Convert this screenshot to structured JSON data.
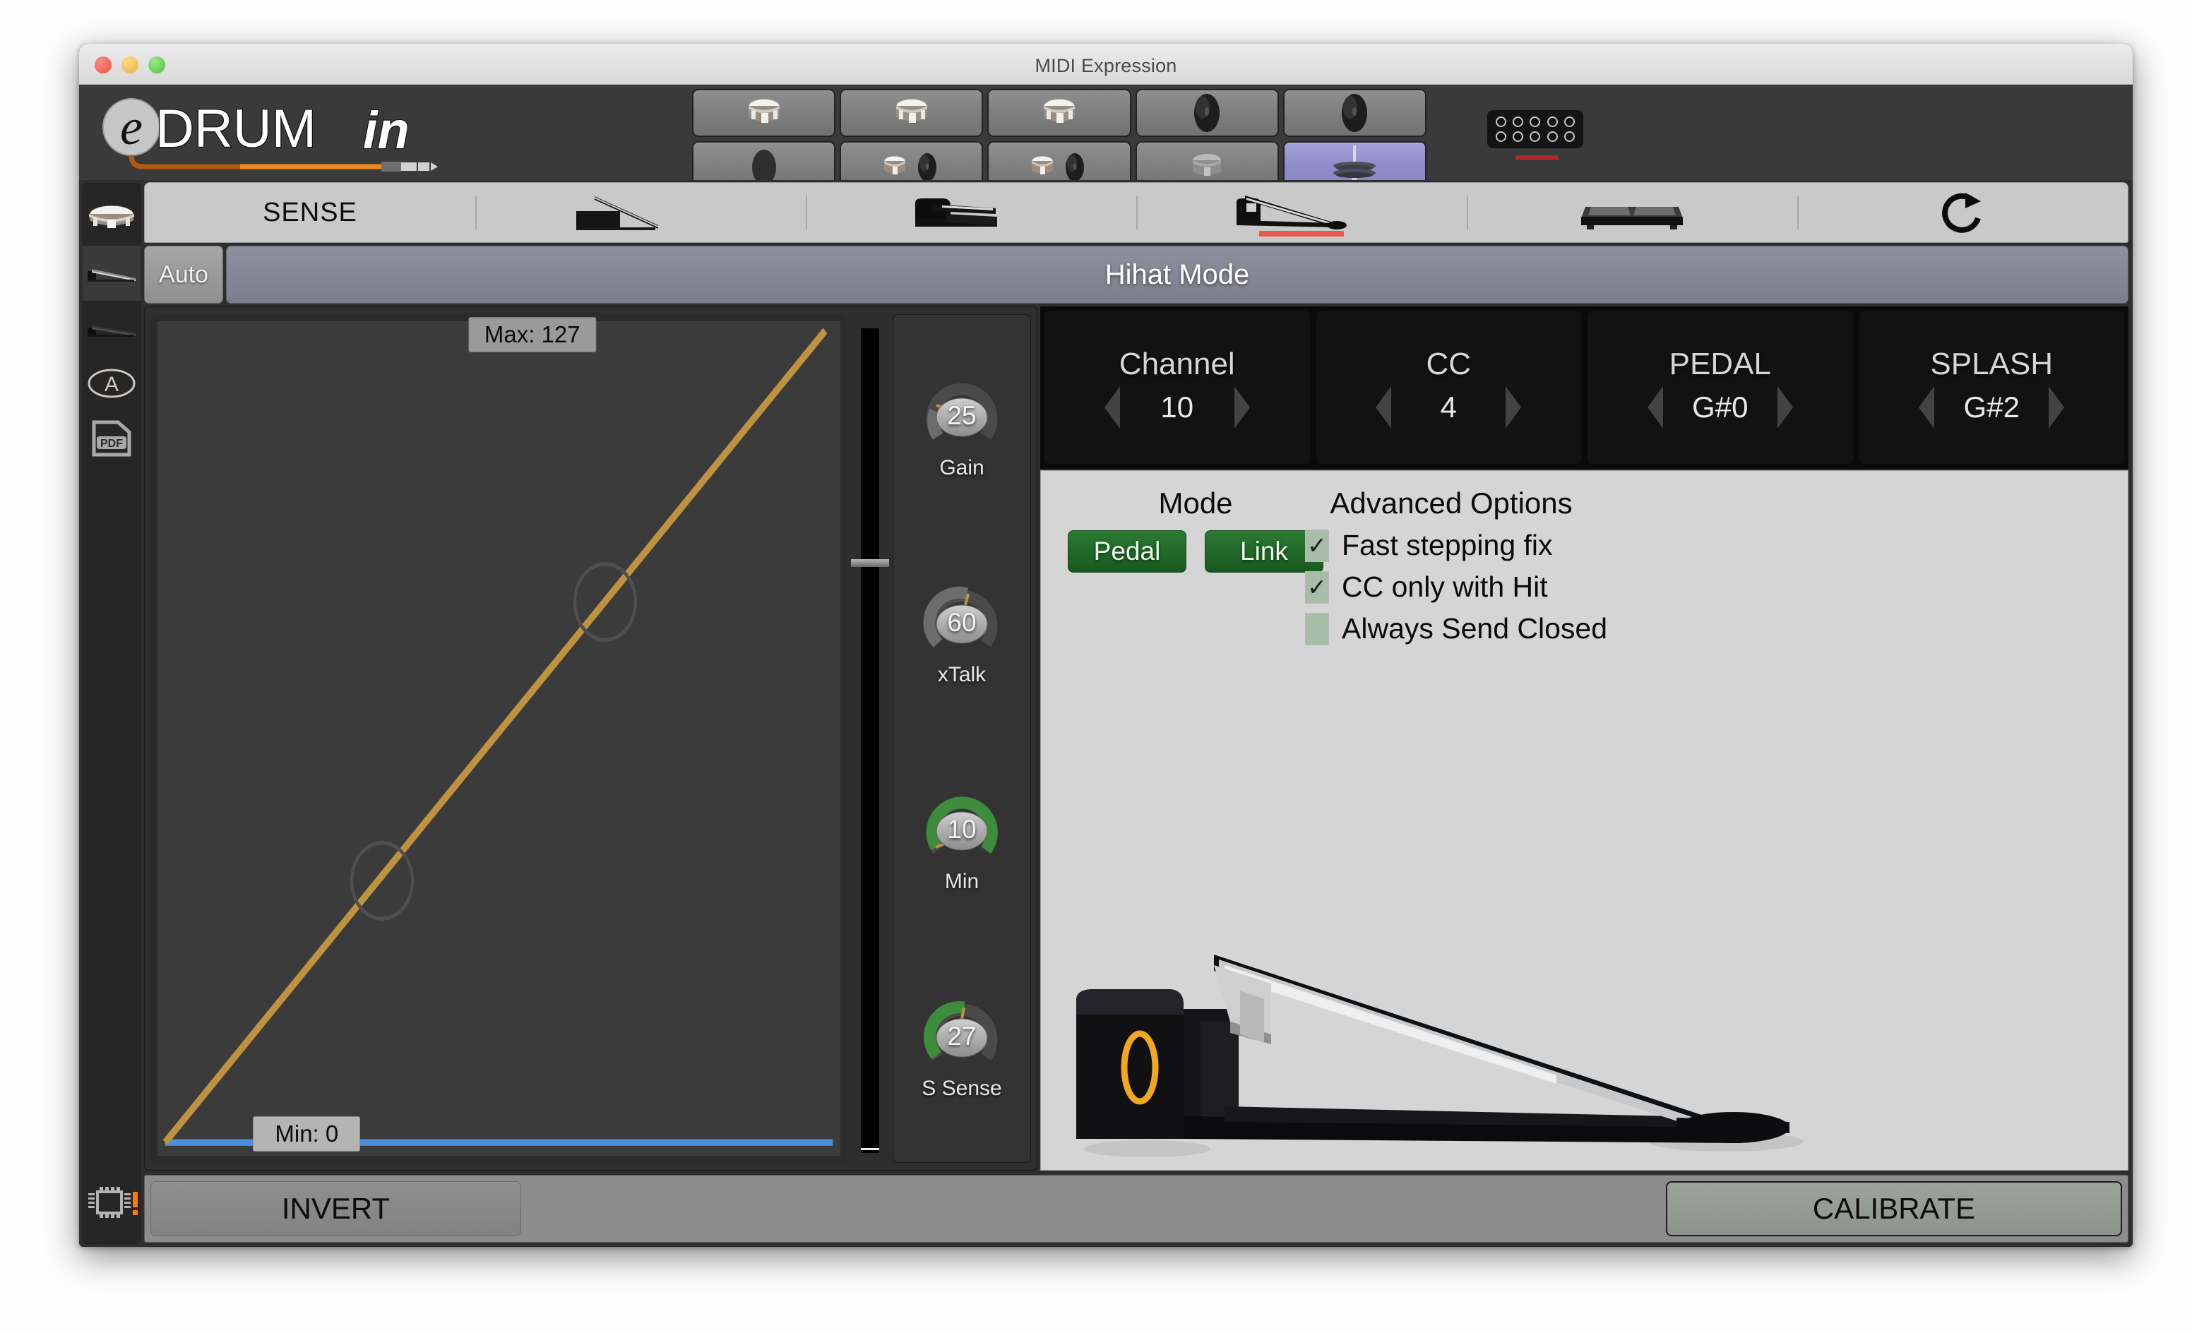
{
  "window": {
    "title": "MIDI Expression",
    "traffic_lights": [
      "close-button",
      "minimize-button",
      "maximize-button"
    ]
  },
  "brand": {
    "logo_text_a": "e",
    "logo_text_b": "DRUM",
    "logo_text_c": "in",
    "accent_orange": "#e87e1e"
  },
  "pads": [
    {
      "name": "pad-1-drum",
      "icon": "snare-drum-icon",
      "selected": false
    },
    {
      "name": "pad-2-drum",
      "icon": "snare-drum-icon",
      "selected": false
    },
    {
      "name": "pad-3-drum",
      "icon": "snare-drum-icon",
      "selected": false
    },
    {
      "name": "pad-4-cymbal",
      "icon": "cymbal-icon",
      "selected": false
    },
    {
      "name": "pad-5-cymbal",
      "icon": "cymbal-icon",
      "selected": false
    },
    {
      "name": "pad-6-empty",
      "icon": "empty-pad-icon",
      "selected": false
    },
    {
      "name": "pad-7-drum-cymbal",
      "icon": "drum-cymbal-pair-icon",
      "selected": false
    },
    {
      "name": "pad-8-drum-cymbal",
      "icon": "drum-cymbal-pair-icon",
      "selected": false
    },
    {
      "name": "pad-9-drum-dim",
      "icon": "drum-dim-icon",
      "selected": false
    },
    {
      "name": "pad-10-hihat",
      "icon": "hihat-icon",
      "selected": true
    }
  ],
  "led_panel": {
    "rows": 2,
    "columns": 5,
    "bar_color": "#b02a2a"
  },
  "sidebar": {
    "items": [
      {
        "name": "sidebar-item-drum",
        "icon": "snare-drum-icon",
        "active": false
      },
      {
        "name": "sidebar-item-pedal-1",
        "icon": "pedal-icon",
        "active": true
      },
      {
        "name": "sidebar-item-pedal-2",
        "icon": "pedal-icon",
        "active": false
      },
      {
        "name": "sidebar-item-auto",
        "icon": "circle-a-icon",
        "active": false
      },
      {
        "name": "sidebar-item-pdf",
        "icon": "pdf-icon",
        "label": "PDF",
        "active": false
      },
      {
        "name": "sidebar-item-firmware",
        "icon": "chip-icon",
        "active": false,
        "alert": true
      }
    ]
  },
  "tabs": [
    {
      "name": "tab-sense",
      "label": "SENSE",
      "icon": null,
      "selected": false
    },
    {
      "name": "tab-pedal-flat",
      "label": "",
      "icon": "pedal-flat-icon",
      "selected": false
    },
    {
      "name": "tab-pedal-down",
      "label": "",
      "icon": "pedal-down-icon",
      "selected": false
    },
    {
      "name": "tab-pedal-open",
      "label": "",
      "icon": "pedal-open-icon",
      "selected": true
    },
    {
      "name": "tab-switch",
      "label": "",
      "icon": "dual-switch-icon",
      "selected": false
    },
    {
      "name": "tab-refresh",
      "label": "",
      "icon": "refresh-icon",
      "selected": false
    }
  ],
  "mode_bar": {
    "auto_label": "Auto",
    "title": "Hihat Mode"
  },
  "chart_data": {
    "type": "line",
    "title": "",
    "max_label": "Max: 127",
    "min_label": "Min: 0",
    "max_value": 127,
    "min_value": 0,
    "xlim": [
      0,
      127
    ],
    "ylim": [
      0,
      127
    ],
    "grid": false,
    "curve_color": "#bf9240",
    "min_line_color": "#4a90d9",
    "series": [
      {
        "name": "response-curve",
        "x": [
          0,
          32,
          64,
          96,
          127
        ],
        "y": [
          0,
          32,
          64,
          96,
          127
        ]
      }
    ],
    "control_points": [
      {
        "x": 32,
        "y": 32
      },
      {
        "x": 80,
        "y": 80
      }
    ]
  },
  "slider": {
    "name": "threshold-slider",
    "position_pct": 28
  },
  "knobs": [
    {
      "name": "gain-knob",
      "label": "Gain",
      "value": "25",
      "pct": 20,
      "arc_color": "#6c6c6c"
    },
    {
      "name": "xtalk-knob",
      "label": "xTalk",
      "value": "60",
      "pct": 48,
      "arc_color": "#6c6c6c"
    },
    {
      "name": "min-knob",
      "label": "Min",
      "value": "10",
      "pct": 93,
      "arc_color": "#3c8c3c"
    },
    {
      "name": "ssense-knob",
      "label": "S Sense",
      "value": "27",
      "pct": 47,
      "arc_color": "#3c8c3c"
    }
  ],
  "midi": [
    {
      "name": "channel-stepper",
      "title": "Channel",
      "value": "10"
    },
    {
      "name": "cc-stepper",
      "title": "CC",
      "value": "4"
    },
    {
      "name": "pedal-stepper",
      "title": "PEDAL",
      "value": "G#0"
    },
    {
      "name": "splash-stepper",
      "title": "SPLASH",
      "value": "G#2"
    }
  ],
  "mode": {
    "heading": "Mode",
    "buttons": [
      {
        "name": "mode-pedal-button",
        "label": "Pedal",
        "active": true
      },
      {
        "name": "mode-link-button",
        "label": "Link",
        "active": true
      }
    ]
  },
  "advanced_options": {
    "heading": "Advanced Options",
    "items": [
      {
        "name": "option-fast-stepping-fix",
        "label": "Fast stepping fix",
        "checked": true
      },
      {
        "name": "option-cc-only-with-hit",
        "label": "CC only with Hit",
        "checked": true
      },
      {
        "name": "option-always-send-closed",
        "label": "Always Send Closed",
        "checked": false
      }
    ]
  },
  "pedal_illustration": {
    "name": "hihat-pedal-illustration",
    "display_value": "0",
    "display_color": "#f0a81e"
  },
  "bottom": {
    "invert_label": "INVERT",
    "calibrate_label": "CALIBRATE"
  }
}
